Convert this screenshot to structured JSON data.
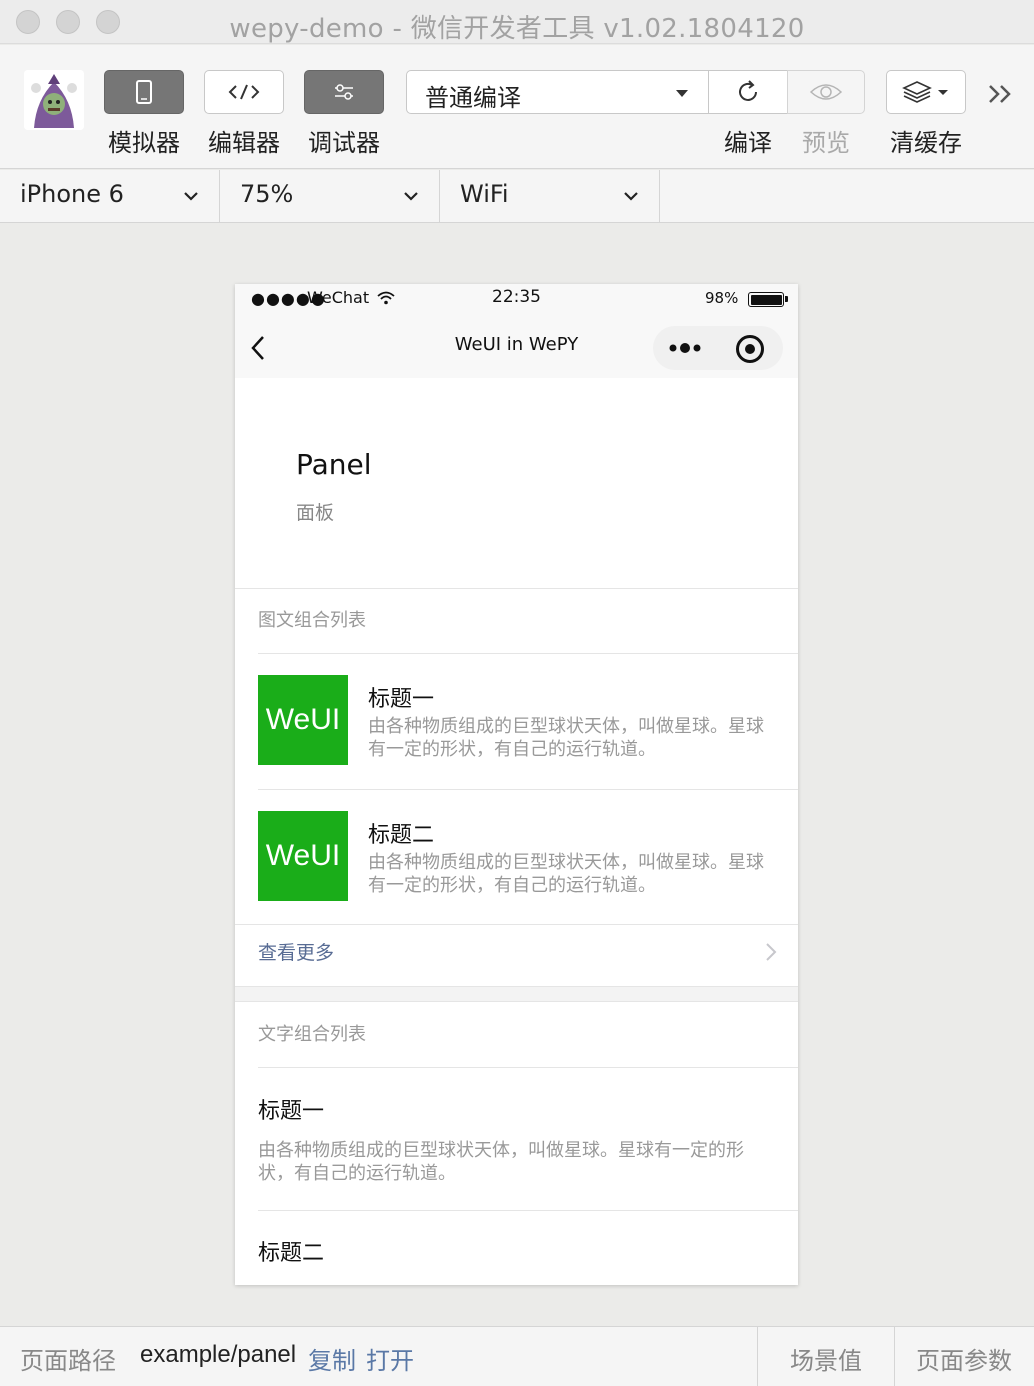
{
  "window": {
    "title": "wepy-demo - 微信开发者工具 v1.02.1804120"
  },
  "toolbar": {
    "simulator_label": "模拟器",
    "editor_label": "编辑器",
    "debugger_label": "调试器",
    "compile_mode": "普通编译",
    "compile_label": "编译",
    "preview_label": "预览",
    "clear_cache_label": "清缓存"
  },
  "device_bar": {
    "device": "iPhone 6",
    "zoom": "75%",
    "network": "WiFi"
  },
  "phone": {
    "status": {
      "signal": "●●●●●",
      "carrier": "WeChat",
      "time": "22:35",
      "battery": "98%"
    },
    "nav_title": "WeUI in WePY",
    "page_title": "Panel",
    "page_desc": "面板",
    "media_panel": {
      "header": "图文组合列表",
      "items": [
        {
          "thumb": "WeUI",
          "title": "标题一",
          "desc": "由各种物质组成的巨型球状天体，叫做星球。星球有一定的形状，有自己的运行轨道。"
        },
        {
          "thumb": "WeUI",
          "title": "标题二",
          "desc": "由各种物质组成的巨型球状天体，叫做星球。星球有一定的形状，有自己的运行轨道。"
        }
      ],
      "more": "查看更多"
    },
    "text_panel": {
      "header": "文字组合列表",
      "items": [
        {
          "title": "标题一",
          "desc": "由各种物质组成的巨型球状天体，叫做星球。星球有一定的形状，有自己的运行轨道。"
        },
        {
          "title": "标题二",
          "desc": ""
        }
      ]
    }
  },
  "bottom_bar": {
    "path_label": "页面路径",
    "path_value": "example/panel",
    "copy_label": "复制",
    "open_label": "打开",
    "scene_label": "场景值",
    "params_label": "页面参数"
  },
  "colors": {
    "weui_green": "#1aad19",
    "link_blue": "#586c94"
  }
}
